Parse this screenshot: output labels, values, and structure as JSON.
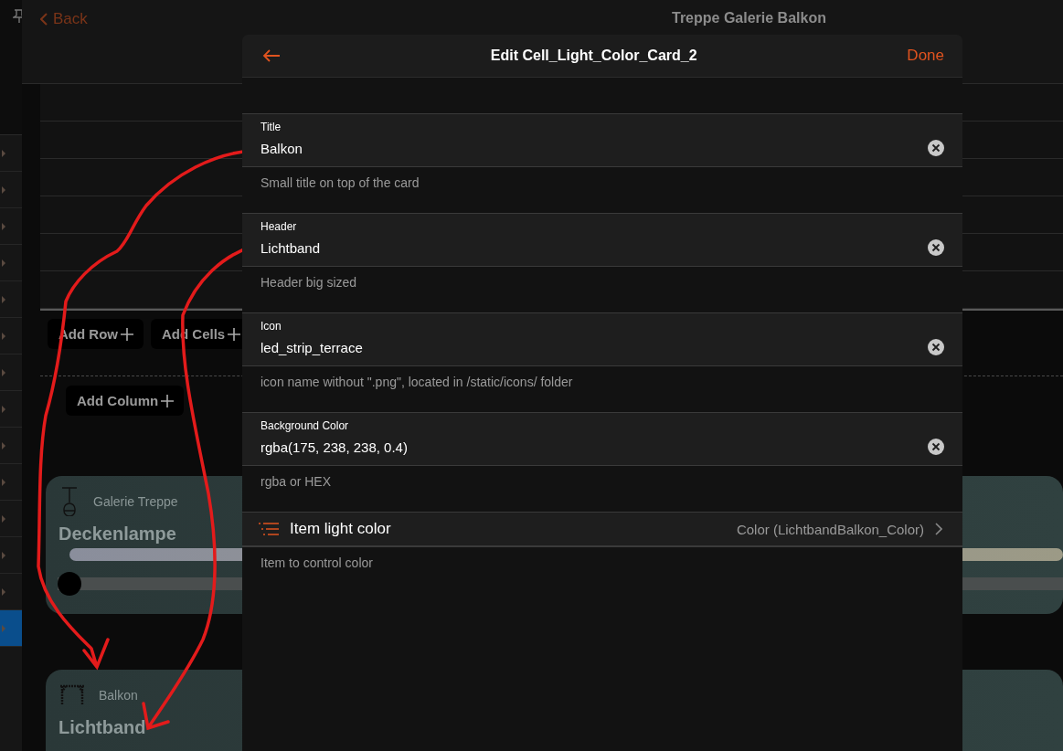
{
  "sidebar": {
    "items": [
      {
        "selected": false
      },
      {
        "selected": false
      },
      {
        "selected": false
      },
      {
        "selected": false
      },
      {
        "selected": false
      },
      {
        "selected": false
      },
      {
        "selected": false
      },
      {
        "selected": false
      },
      {
        "selected": false
      },
      {
        "selected": false
      },
      {
        "selected": false
      },
      {
        "selected": false
      },
      {
        "selected": false
      },
      {
        "selected": true
      }
    ]
  },
  "header": {
    "back": "Back",
    "title": "Treppe Galerie Balkon"
  },
  "toolbar": {
    "buttons": [
      "Add Row",
      "Add Cells"
    ],
    "add_column": "Add Column"
  },
  "cards": [
    {
      "kind": "pendant",
      "subtitle": "Galerie Treppe",
      "title": "Deckenlampe",
      "level": 0
    },
    {
      "kind": "strip",
      "subtitle": "Balkon",
      "title": "Lichtband"
    }
  ],
  "dialog": {
    "title": "Edit Cell_Light_Color_Card_2",
    "done": "Done",
    "fields": [
      {
        "kind": "text",
        "label": "Title",
        "value": "Balkon",
        "hint": "Small title on top of the card"
      },
      {
        "kind": "text",
        "label": "Header",
        "value": "Lichtband",
        "hint": "Header big sized"
      },
      {
        "kind": "text",
        "label": "Icon",
        "value": "led_strip_terrace",
        "hint": "icon name without \".png\", located in /static/icons/ folder"
      },
      {
        "kind": "text",
        "label": "Background Color",
        "value": "rgba(175, 238, 238, 0.4)",
        "hint": "rgba or HEX"
      },
      {
        "kind": "item",
        "label": "Item light color",
        "value": "Color (LichtbandBalkon_Color)",
        "hint": "Item to control color"
      }
    ]
  }
}
